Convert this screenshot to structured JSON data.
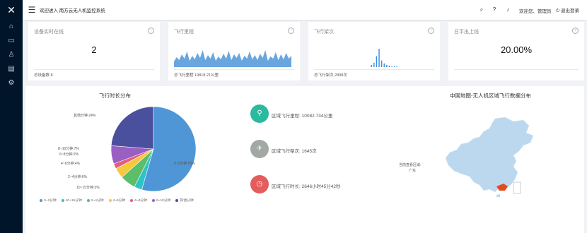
{
  "header": {
    "welcome": "欢迎进入 南方云无人机监控系统",
    "user": "欢迎您、管理员",
    "logout": "退出登录"
  },
  "cards": [
    {
      "title": "设备实时在线",
      "value": "2",
      "footer": "总设备数 8"
    },
    {
      "title": "飞行里程",
      "footer": "总飞行里程 19818.21公里"
    },
    {
      "title": "飞行架次",
      "footer": "总飞行架次 2898次"
    },
    {
      "title": "日平出上线",
      "value": "20.00%"
    }
  ],
  "sparklines": {
    "mileage": [
      8,
      14,
      10,
      18,
      12,
      22,
      9,
      16,
      11,
      20,
      13,
      24,
      10,
      17,
      12,
      21,
      9,
      15,
      11,
      19,
      12,
      23,
      10,
      18,
      13,
      20,
      9,
      16,
      12,
      22,
      11,
      17,
      10,
      19,
      13,
      24,
      9,
      15,
      12,
      21,
      10,
      18,
      11,
      20,
      12,
      16
    ],
    "flights": [
      0,
      0,
      0,
      0,
      0,
      0,
      0,
      0,
      0,
      0,
      0,
      0,
      0,
      0,
      0,
      0,
      0,
      0,
      0,
      0,
      0,
      0,
      3,
      6,
      15,
      25,
      9,
      5,
      3,
      2,
      1,
      1,
      1,
      0,
      0,
      0,
      0,
      0,
      0,
      0,
      0,
      0,
      0,
      0,
      0,
      0
    ]
  },
  "pie": {
    "title": "飞行时长分布",
    "labels": {
      "other": "其他分钟:24%",
      "r8_10": "8~10分钟:7%",
      "r6_8": "6~8分钟:2%",
      "r4_6": "4~6分钟:4%",
      "r2_4": "2~4分钟:6%",
      "r10_15": "10~15分钟:3%",
      "r0_2": "0~2分钟:55%"
    },
    "legend": [
      "0~2分钟",
      "10~15分钟",
      "2~4分钟",
      "4~6分钟",
      "6~8分钟",
      "8~10分钟",
      "其他分钟"
    ]
  },
  "chart_data": {
    "type": "pie",
    "title": "飞行时长分布",
    "categories": [
      "0~2分钟",
      "10~15分钟",
      "2~4分钟",
      "4~6分钟",
      "6~8分钟",
      "8~10分钟",
      "其他分钟"
    ],
    "values": [
      55,
      3,
      6,
      4,
      2,
      7,
      24
    ],
    "colors": [
      "#4e96d6",
      "#2ec4c4",
      "#5cbd6a",
      "#f5c93e",
      "#e65c7a",
      "#9a5fc3",
      "#4a4f9e"
    ],
    "legend_position": "bottom"
  },
  "stats": [
    {
      "label": "区域飞行里程: 10082.734公里",
      "color": "#2bb9a0"
    },
    {
      "label": "区域飞行架次: 1645次",
      "color": "#a2a9a5"
    },
    {
      "label": "区域飞行时长: 2646小时45分42秒",
      "color": "#e45c5c"
    }
  ],
  "map": {
    "title": "中国地图-无人机区域飞行数据分布",
    "label_line1": "当前查看区域:",
    "label_line2": "广东"
  }
}
